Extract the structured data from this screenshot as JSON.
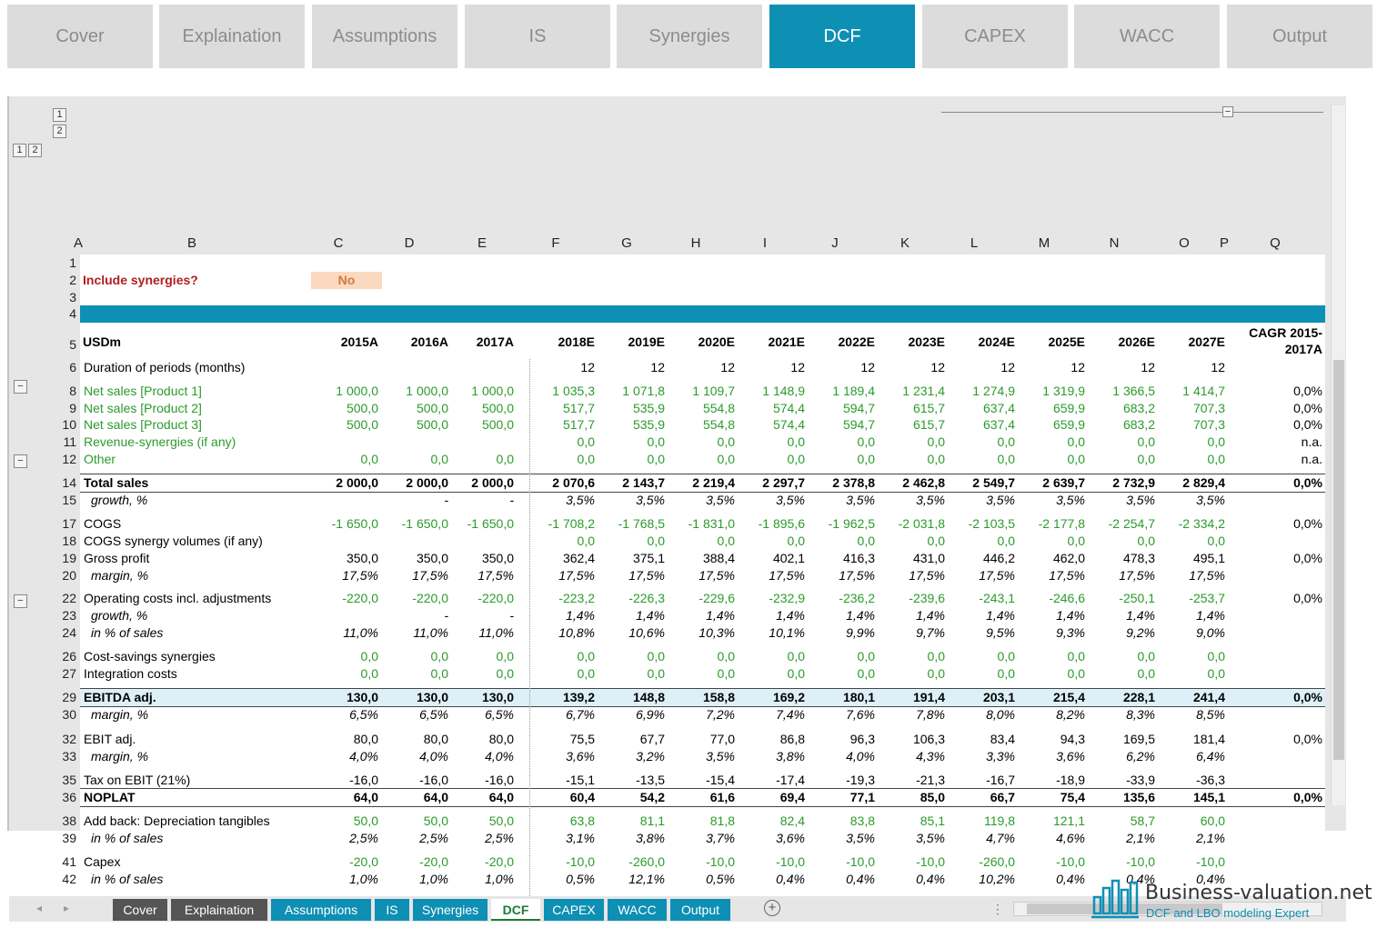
{
  "nav": {
    "tabs": [
      "Cover",
      "Explaination",
      "Assumptions",
      "IS",
      "Synergies",
      "DCF",
      "CAPEX",
      "WACC",
      "Output"
    ],
    "active": "DCF",
    "active_color": "#0e8fb4"
  },
  "outline_buttons": {
    "levels_top": [
      "1",
      "2"
    ],
    "levels_left": [
      "1",
      "2"
    ],
    "collapse": "−"
  },
  "columns": [
    "A",
    "B",
    "C",
    "D",
    "E",
    "F",
    "G",
    "H",
    "I",
    "J",
    "K",
    "L",
    "M",
    "N",
    "O",
    "P",
    "Q"
  ],
  "sheet": {
    "row_numbers": [
      "1",
      "2",
      "3",
      "4",
      "5",
      "6",
      "8",
      "9",
      "10",
      "11",
      "12",
      "14",
      "15",
      "17",
      "18",
      "19",
      "20",
      "22",
      "23",
      "24",
      "26",
      "27",
      "29",
      "30",
      "32",
      "33",
      "35",
      "36",
      "38",
      "39",
      "41",
      "42"
    ],
    "include_synergies_label": "Include synergies?",
    "include_synergies_value": "No",
    "units_label": "USDm",
    "years": [
      "2015A",
      "2016A",
      "2017A",
      "2018E",
      "2019E",
      "2020E",
      "2021E",
      "2022E",
      "2023E",
      "2024E",
      "2025E",
      "2026E",
      "2027E"
    ],
    "cagr_header_1": "CAGR 2015-",
    "cagr_header_2": "2017A",
    "rows": [
      {
        "label": "Duration of periods (months)",
        "vals": [
          "",
          "",
          "",
          "12",
          "12",
          "12",
          "12",
          "12",
          "12",
          "12",
          "12",
          "12",
          "12"
        ],
        "cagr": "",
        "style": ""
      },
      {
        "label": "Net sales [Product 1]",
        "vals": [
          "1 000,0",
          "1 000,0",
          "1 000,0",
          "1 035,3",
          "1 071,8",
          "1 109,7",
          "1 148,9",
          "1 189,4",
          "1 231,4",
          "1 274,9",
          "1 319,9",
          "1 366,5",
          "1 414,7"
        ],
        "cagr": "0,0%",
        "style": "green"
      },
      {
        "label": "Net sales [Product 2]",
        "vals": [
          "500,0",
          "500,0",
          "500,0",
          "517,7",
          "535,9",
          "554,8",
          "574,4",
          "594,7",
          "615,7",
          "637,4",
          "659,9",
          "683,2",
          "707,3"
        ],
        "cagr": "0,0%",
        "style": "green"
      },
      {
        "label": "Net sales [Product 3]",
        "vals": [
          "500,0",
          "500,0",
          "500,0",
          "517,7",
          "535,9",
          "554,8",
          "574,4",
          "594,7",
          "615,7",
          "637,4",
          "659,9",
          "683,2",
          "707,3"
        ],
        "cagr": "0,0%",
        "style": "green"
      },
      {
        "label": "Revenue-synergies (if any)",
        "vals": [
          "",
          "",
          "",
          "0,0",
          "0,0",
          "0,0",
          "0,0",
          "0,0",
          "0,0",
          "0,0",
          "0,0",
          "0,0",
          "0,0"
        ],
        "cagr": "n.a.",
        "style": "green"
      },
      {
        "label": "Other",
        "vals": [
          "0,0",
          "0,0",
          "0,0",
          "0,0",
          "0,0",
          "0,0",
          "0,0",
          "0,0",
          "0,0",
          "0,0",
          "0,0",
          "0,0",
          "0,0"
        ],
        "cagr": "n.a.",
        "style": "green"
      },
      {
        "label": "Total sales",
        "vals": [
          "2 000,0",
          "2 000,0",
          "2 000,0",
          "2 070,6",
          "2 143,7",
          "2 219,4",
          "2 297,7",
          "2 378,8",
          "2 462,8",
          "2 549,7",
          "2 639,7",
          "2 732,9",
          "2 829,4"
        ],
        "cagr": "0,0%",
        "style": "bold"
      },
      {
        "label": "growth, %",
        "vals": [
          "",
          "-",
          "-",
          "3,5%",
          "3,5%",
          "3,5%",
          "3,5%",
          "3,5%",
          "3,5%",
          "3,5%",
          "3,5%",
          "3,5%",
          "3,5%"
        ],
        "cagr": "",
        "style": "italic"
      },
      {
        "label": "COGS",
        "vals": [
          "-1 650,0",
          "-1 650,0",
          "-1 650,0",
          "-1 708,2",
          "-1 768,5",
          "-1 831,0",
          "-1 895,6",
          "-1 962,5",
          "-2 031,8",
          "-2 103,5",
          "-2 177,8",
          "-2 254,7",
          "-2 334,2"
        ],
        "cagr": "0,0%",
        "style": "greenvals"
      },
      {
        "label": "COGS synergy volumes (if any)",
        "vals": [
          "",
          "",
          "",
          "0,0",
          "0,0",
          "0,0",
          "0,0",
          "0,0",
          "0,0",
          "0,0",
          "0,0",
          "0,0",
          "0,0"
        ],
        "cagr": "",
        "style": "greenvals"
      },
      {
        "label": "Gross profit",
        "vals": [
          "350,0",
          "350,0",
          "350,0",
          "362,4",
          "375,1",
          "388,4",
          "402,1",
          "416,3",
          "431,0",
          "446,2",
          "462,0",
          "478,3",
          "495,1"
        ],
        "cagr": "0,0%",
        "style": ""
      },
      {
        "label": "margin, %",
        "vals": [
          "17,5%",
          "17,5%",
          "17,5%",
          "17,5%",
          "17,5%",
          "17,5%",
          "17,5%",
          "17,5%",
          "17,5%",
          "17,5%",
          "17,5%",
          "17,5%",
          "17,5%"
        ],
        "cagr": "",
        "style": "italic"
      },
      {
        "label": "Operating costs incl. adjustments",
        "vals": [
          "-220,0",
          "-220,0",
          "-220,0",
          "-223,2",
          "-226,3",
          "-229,6",
          "-232,9",
          "-236,2",
          "-239,6",
          "-243,1",
          "-246,6",
          "-250,1",
          "-253,7"
        ],
        "cagr": "0,0%",
        "style": "greenvals"
      },
      {
        "label": "growth, %",
        "vals": [
          "",
          "-",
          "-",
          "1,4%",
          "1,4%",
          "1,4%",
          "1,4%",
          "1,4%",
          "1,4%",
          "1,4%",
          "1,4%",
          "1,4%",
          "1,4%"
        ],
        "cagr": "",
        "style": "italic"
      },
      {
        "label": "in % of sales",
        "vals": [
          "11,0%",
          "11,0%",
          "11,0%",
          "10,8%",
          "10,6%",
          "10,3%",
          "10,1%",
          "9,9%",
          "9,7%",
          "9,5%",
          "9,3%",
          "9,2%",
          "9,0%"
        ],
        "cagr": "",
        "style": "italic"
      },
      {
        "label": "Cost-savings synergies",
        "vals": [
          "0,0",
          "0,0",
          "0,0",
          "0,0",
          "0,0",
          "0,0",
          "0,0",
          "0,0",
          "0,0",
          "0,0",
          "0,0",
          "0,0",
          "0,0"
        ],
        "cagr": "",
        "style": "greenvals"
      },
      {
        "label": "Integration costs",
        "vals": [
          "0,0",
          "0,0",
          "0,0",
          "0,0",
          "0,0",
          "0,0",
          "0,0",
          "0,0",
          "0,0",
          "0,0",
          "0,0",
          "0,0",
          "0,0"
        ],
        "cagr": "",
        "style": "greenvals"
      },
      {
        "label": "EBITDA adj.",
        "vals": [
          "130,0",
          "130,0",
          "130,0",
          "139,2",
          "148,8",
          "158,8",
          "169,2",
          "180,1",
          "191,4",
          "203,1",
          "215,4",
          "228,1",
          "241,4"
        ],
        "cagr": "0,0%",
        "style": "bold"
      },
      {
        "label": "margin, %",
        "vals": [
          "6,5%",
          "6,5%",
          "6,5%",
          "6,7%",
          "6,9%",
          "7,2%",
          "7,4%",
          "7,6%",
          "7,8%",
          "8,0%",
          "8,2%",
          "8,3%",
          "8,5%"
        ],
        "cagr": "",
        "style": "italic"
      },
      {
        "label": "EBIT adj.",
        "vals": [
          "80,0",
          "80,0",
          "80,0",
          "75,5",
          "67,7",
          "77,0",
          "86,8",
          "96,3",
          "106,3",
          "83,4",
          "94,3",
          "169,5",
          "181,4"
        ],
        "cagr": "0,0%",
        "style": ""
      },
      {
        "label": "margin, %",
        "vals": [
          "4,0%",
          "4,0%",
          "4,0%",
          "3,6%",
          "3,2%",
          "3,5%",
          "3,8%",
          "4,0%",
          "4,3%",
          "3,3%",
          "3,6%",
          "6,2%",
          "6,4%"
        ],
        "cagr": "",
        "style": "italic"
      },
      {
        "label": "Tax on EBIT (21%)",
        "vals": [
          "-16,0",
          "-16,0",
          "-16,0",
          "-15,1",
          "-13,5",
          "-15,4",
          "-17,4",
          "-19,3",
          "-21,3",
          "-16,7",
          "-18,9",
          "-33,9",
          "-36,3"
        ],
        "cagr": "",
        "style": ""
      },
      {
        "label": "NOPLAT",
        "vals": [
          "64,0",
          "64,0",
          "64,0",
          "60,4",
          "54,2",
          "61,6",
          "69,4",
          "77,1",
          "85,0",
          "66,7",
          "75,4",
          "135,6",
          "145,1"
        ],
        "cagr": "0,0%",
        "style": "bold"
      },
      {
        "label": "Add back: Depreciation tangibles",
        "vals": [
          "50,0",
          "50,0",
          "50,0",
          "63,8",
          "81,1",
          "81,8",
          "82,4",
          "83,8",
          "85,1",
          "119,8",
          "121,1",
          "58,7",
          "60,0"
        ],
        "cagr": "",
        "style": "greenvals"
      },
      {
        "label": "in % of sales",
        "vals": [
          "2,5%",
          "2,5%",
          "2,5%",
          "3,1%",
          "3,8%",
          "3,7%",
          "3,6%",
          "3,5%",
          "3,5%",
          "4,7%",
          "4,6%",
          "2,1%",
          "2,1%"
        ],
        "cagr": "",
        "style": "italic"
      },
      {
        "label": "Capex",
        "vals": [
          "-20,0",
          "-20,0",
          "-20,0",
          "-10,0",
          "-260,0",
          "-10,0",
          "-10,0",
          "-10,0",
          "-10,0",
          "-260,0",
          "-10,0",
          "-10,0",
          "-10,0"
        ],
        "cagr": "",
        "style": "greenvals"
      },
      {
        "label": "in % of sales",
        "vals": [
          "1,0%",
          "1,0%",
          "1,0%",
          "0,5%",
          "12,1%",
          "0,5%",
          "0,4%",
          "0,4%",
          "0,4%",
          "10,2%",
          "0,4%",
          "0,4%",
          "0,4%"
        ],
        "cagr": "",
        "style": "italic"
      }
    ]
  },
  "sheet_tabs": [
    {
      "label": "Cover",
      "color": "#555555"
    },
    {
      "label": "Explaination",
      "color": "#555555"
    },
    {
      "label": "Assumptions",
      "color": "#0e8fb4"
    },
    {
      "label": "IS",
      "color": "#0e8fb4"
    },
    {
      "label": "Synergies",
      "color": "#0e8fb4"
    },
    {
      "label": "DCF",
      "color": "#ffffff",
      "active": true
    },
    {
      "label": "CAPEX",
      "color": "#0e8fb4"
    },
    {
      "label": "WACC",
      "color": "#0e8fb4"
    },
    {
      "label": "Output",
      "color": "#0e8fb4"
    }
  ],
  "add_sheet_icon": "plus-circle-icon",
  "brand": {
    "name": "Business-valuation.net",
    "tagline": "DCF and LBO modeling Expert",
    "color": "#0e8fb4"
  }
}
